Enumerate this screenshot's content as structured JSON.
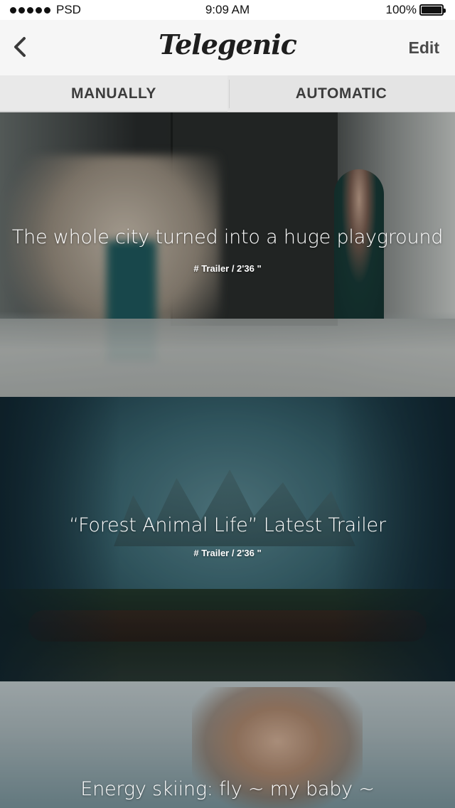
{
  "status_bar": {
    "carrier": "PSD",
    "time": "9:09 AM",
    "battery_percent": "100%"
  },
  "nav": {
    "logo_text": "Telegenic",
    "edit_label": "Edit"
  },
  "tabs": [
    {
      "label": "MANUALLY",
      "active": true
    },
    {
      "label": "AUTOMATIC",
      "active": false
    }
  ],
  "cards": [
    {
      "title": "The whole city turned into a huge playground",
      "meta": "# Trailer / 2'36 \""
    },
    {
      "title": "“Forest Animal Life” Latest Trailer",
      "meta": "# Trailer / 2'36 \""
    },
    {
      "title": "Energy skiing: fly ~ my baby ~",
      "meta": ""
    }
  ],
  "icons": {
    "back": "chevron-left-icon",
    "battery": "battery-icon",
    "signal": "signal-dots-icon"
  }
}
